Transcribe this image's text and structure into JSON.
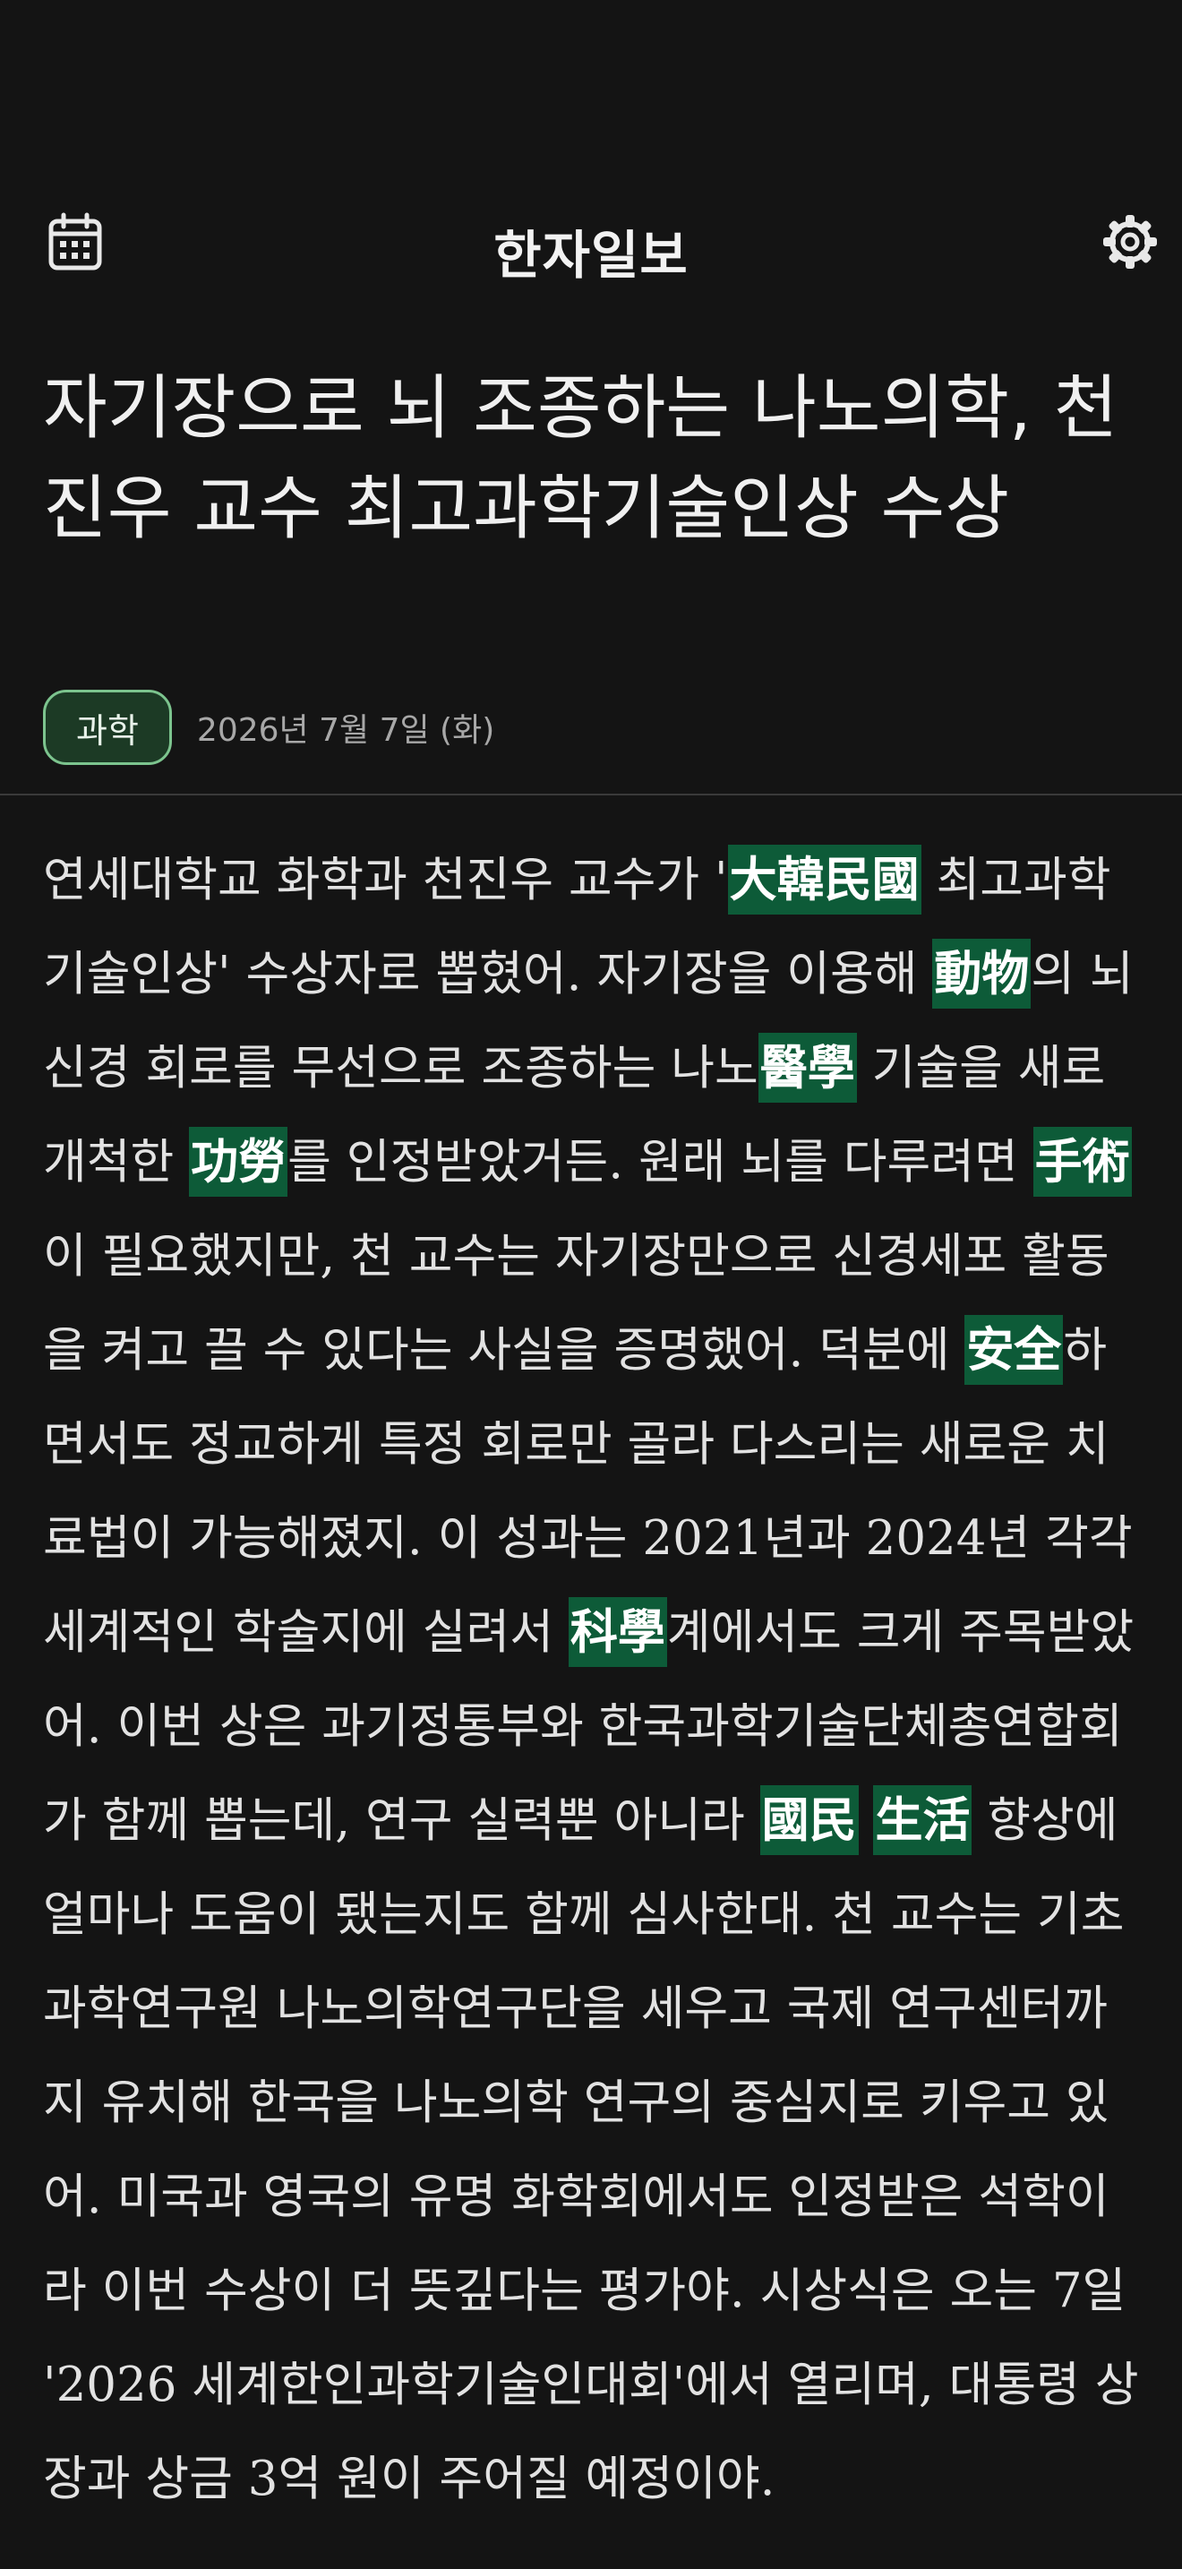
{
  "header": {
    "title": "한자일보",
    "left_icon": "calendar-icon",
    "right_icon": "gear-icon"
  },
  "article": {
    "headline": "자기장으로 뇌 조종하는 나노의학, 천진우 교수 최고과학기술인상 수상",
    "category": "과학",
    "date": "2026년 7월 7일 (화)",
    "body": [
      {
        "t": "연세대학교 화학과 천진우 교수가 '"
      },
      {
        "h": "大韓民國"
      },
      {
        "t": " 최고과학기술인상' 수상자로 뽑혔어. 자기장을 이용해 "
      },
      {
        "h": "動物"
      },
      {
        "t": "의 뇌 신경 회로를 무선으로 조종하는 나노"
      },
      {
        "h": "醫學"
      },
      {
        "t": " 기술을 새로 개척한 "
      },
      {
        "h": "功勞"
      },
      {
        "t": "를 인정받았거든. 원래 뇌를 다루려면 "
      },
      {
        "h": "手術"
      },
      {
        "t": "이 필요했지만, 천 교수는 자기장만으로 신경세포 활동을 켜고 끌 수 있다는 사실을 증명했어. 덕분에 "
      },
      {
        "h": "安全"
      },
      {
        "t": "하면서도 정교하게 특정 회로만 골라 다스리는 새로운 치료법이 가능해졌지. 이 성과는 2021년과 2024년 각각 세계적인 학술지에 실려서 "
      },
      {
        "h": "科學"
      },
      {
        "t": "계에서도 크게 주목받았어. 이번 상은 과기정통부와 한국과학기술단체총연합회가 함께 뽑는데, 연구 실력뿐 아니라 "
      },
      {
        "h": "國民"
      },
      {
        "t": " "
      },
      {
        "h": "生活"
      },
      {
        "t": " 향상에 얼마나 도움이 됐는지도 함께 심사한대. 천 교수는 기초과학연구원 나노의학연구단을 세우고 국제 연구센터까지 유치해 한국을 나노의학 연구의 중심지로 키우고 있어. 미국과 영국의 유명 화학회에서도 인정받은 석학이라 이번 수상이 더 뜻깊다는 평가야. 시상식은 오는 7일 '2026 세계한인과학기술인대회'에서 열리며, 대통령 상장과 상금 3억 원이 주어질 예정이야."
      }
    ]
  },
  "colors": {
    "background": "#141414",
    "highlight": "#0d5b38",
    "badge_border": "#7cc48e",
    "badge_bg": "#1c3a25"
  }
}
